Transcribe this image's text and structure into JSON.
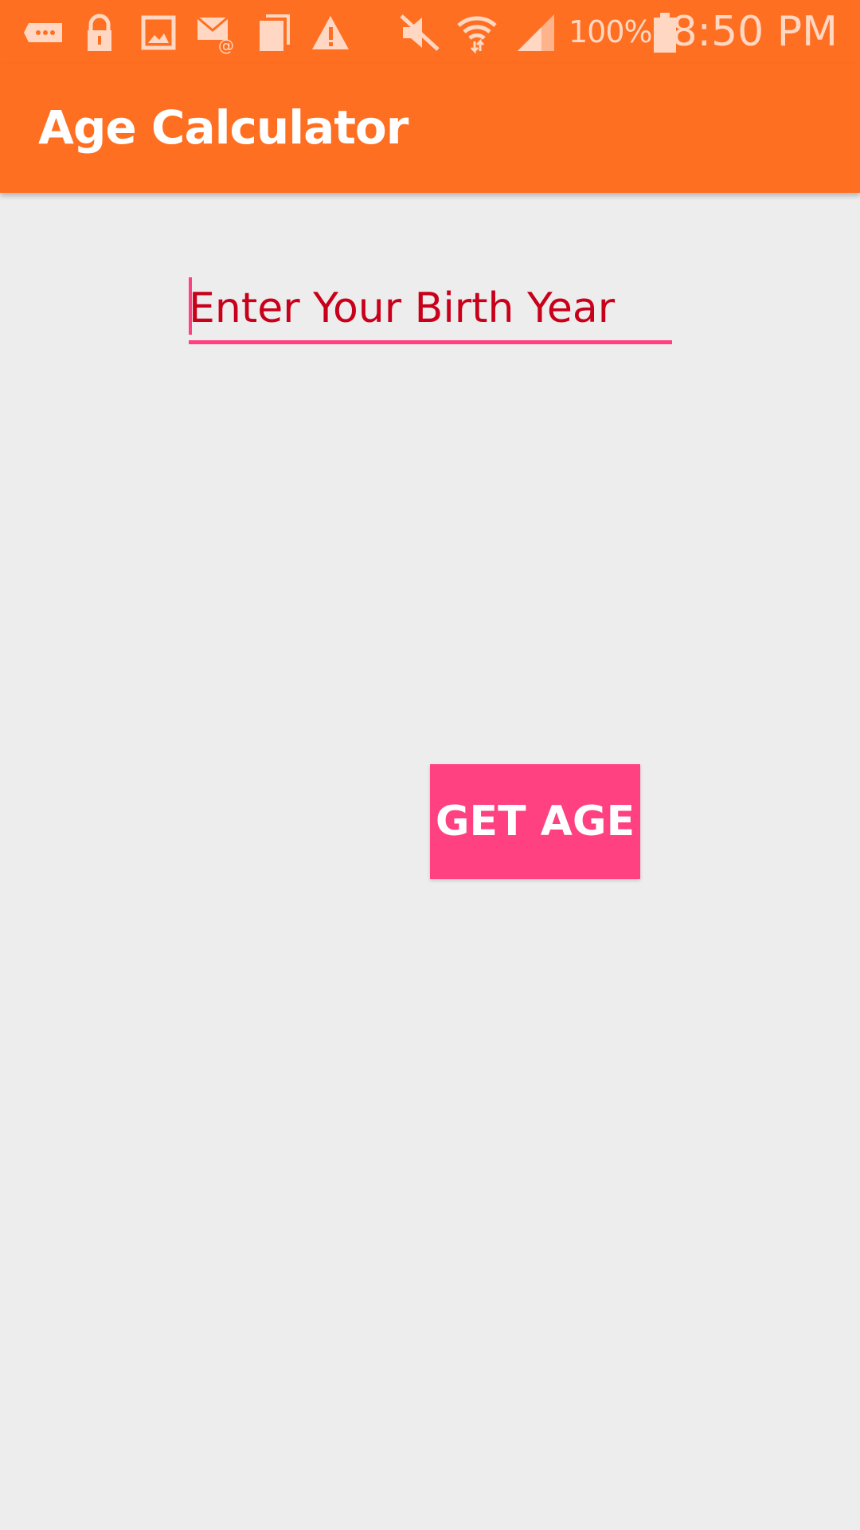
{
  "status_bar": {
    "battery_percent": "100%",
    "time": "8:50 PM",
    "icons": [
      "message-icon",
      "lock-icon",
      "image-icon",
      "email-icon",
      "copy-icon",
      "warning-icon",
      "mute-icon",
      "wifi-icon",
      "signal-icon",
      "battery-icon"
    ]
  },
  "app_bar": {
    "title": "Age Calculator"
  },
  "form": {
    "birth_year_placeholder": "Enter Your Birth Year",
    "birth_year_value": "",
    "get_age_label": "GET AGE"
  },
  "colors": {
    "primary": "#ff6f21",
    "accent": "#ff4081",
    "hint_text": "#c8001a",
    "background": "#eeedee"
  }
}
